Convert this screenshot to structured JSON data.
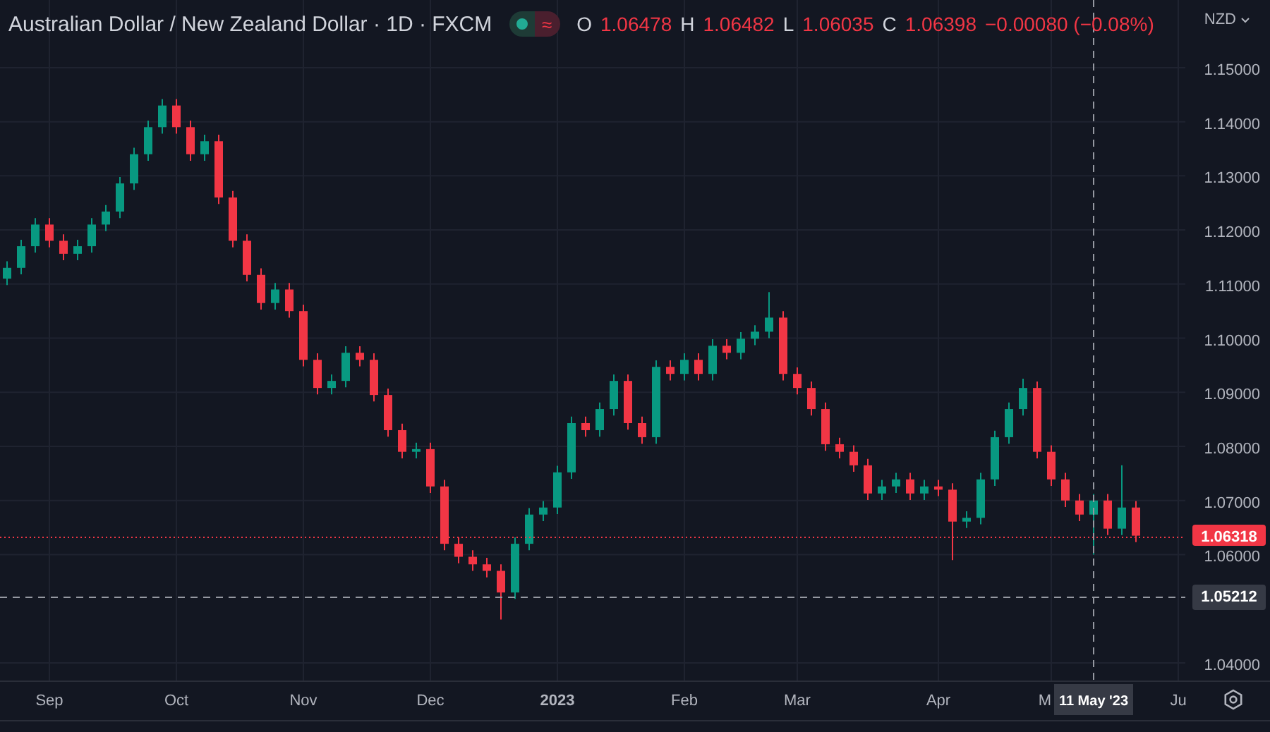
{
  "legend": {
    "title": "Australian Dollar / New Zealand Dollar · 1D · FXCM",
    "market_open": true,
    "status_glyph": "≈",
    "ohlc": [
      {
        "label": "O",
        "value": "1.06478"
      },
      {
        "label": "H",
        "value": "1.06482"
      },
      {
        "label": "L",
        "value": "1.06035"
      },
      {
        "label": "C",
        "value": "1.06398"
      }
    ],
    "change": "−0.00080 (−0.08%)"
  },
  "currency": "NZD",
  "chart_data": {
    "type": "candlestick",
    "grid": true,
    "ylim": [
      1.0366,
      1.1625
    ],
    "categories": [
      null,
      null,
      null,
      "Sep",
      null,
      null,
      null,
      null,
      null,
      null,
      null,
      null,
      "Oct",
      null,
      null,
      null,
      null,
      null,
      null,
      null,
      null,
      "Nov",
      null,
      null,
      null,
      null,
      null,
      null,
      null,
      null,
      "Dec",
      null,
      null,
      null,
      null,
      null,
      null,
      null,
      null,
      "2023",
      null,
      null,
      null,
      null,
      null,
      null,
      null,
      null,
      "Feb",
      null,
      null,
      null,
      null,
      null,
      null,
      null,
      "Mar",
      null,
      null,
      null,
      null,
      null,
      null,
      null,
      null,
      null,
      "Apr",
      null,
      null,
      null,
      null,
      null,
      null,
      null,
      "M",
      null,
      null,
      null,
      null,
      null,
      null,
      null,
      null,
      "Ju"
    ],
    "ohlc": [
      [
        1.111,
        1.1142,
        1.1098,
        1.113
      ],
      [
        1.113,
        1.1182,
        1.1118,
        1.117
      ],
      [
        1.117,
        1.1222,
        1.1158,
        1.121
      ],
      [
        1.121,
        1.1222,
        1.1168,
        1.118
      ],
      [
        1.118,
        1.1192,
        1.1144,
        1.1156
      ],
      [
        1.1156,
        1.1182,
        1.1144,
        1.117
      ],
      [
        1.117,
        1.1222,
        1.1158,
        1.121
      ],
      [
        1.121,
        1.1246,
        1.1198,
        1.1234
      ],
      [
        1.1234,
        1.1298,
        1.1222,
        1.1286
      ],
      [
        1.1286,
        1.1352,
        1.1274,
        1.134
      ],
      [
        1.134,
        1.1402,
        1.1328,
        1.139
      ],
      [
        1.139,
        1.1442,
        1.1378,
        1.143
      ],
      [
        1.143,
        1.1442,
        1.1378,
        1.139
      ],
      [
        1.139,
        1.1402,
        1.1328,
        1.134
      ],
      [
        1.134,
        1.1376,
        1.1328,
        1.1364
      ],
      [
        1.1364,
        1.1376,
        1.1248,
        1.126
      ],
      [
        1.126,
        1.1272,
        1.1168,
        1.118
      ],
      [
        1.118,
        1.1192,
        1.1105,
        1.1117
      ],
      [
        1.1117,
        1.1129,
        1.1053,
        1.1065
      ],
      [
        1.1065,
        1.1102,
        1.1053,
        1.109
      ],
      [
        1.109,
        1.1102,
        1.1038,
        1.105
      ],
      [
        1.105,
        1.1062,
        1.0948,
        1.096
      ],
      [
        1.096,
        1.0972,
        1.0896,
        1.0908
      ],
      [
        1.0908,
        1.0933,
        1.0896,
        1.0921
      ],
      [
        1.0921,
        1.0985,
        1.0909,
        1.0973
      ],
      [
        1.0973,
        1.0985,
        1.0948,
        1.096
      ],
      [
        1.096,
        1.0972,
        1.0883,
        1.0895
      ],
      [
        1.0895,
        1.0907,
        1.0818,
        1.083
      ],
      [
        1.083,
        1.0842,
        1.0778,
        1.079
      ],
      [
        1.079,
        1.0807,
        1.0778,
        1.0795
      ],
      [
        1.0795,
        1.0807,
        1.0714,
        1.0726
      ],
      [
        1.0726,
        1.0738,
        1.0608,
        1.062
      ],
      [
        1.062,
        1.0632,
        1.0584,
        1.0596
      ],
      [
        1.0596,
        1.0608,
        1.057,
        1.0582
      ],
      [
        1.0582,
        1.0594,
        1.0558,
        1.057
      ],
      [
        1.057,
        1.0582,
        1.048,
        1.053
      ],
      [
        1.053,
        1.0632,
        1.0518,
        1.062
      ],
      [
        1.062,
        1.0686,
        1.0608,
        1.0674
      ],
      [
        1.0674,
        1.0699,
        1.0662,
        1.0687
      ],
      [
        1.0687,
        1.0764,
        1.0675,
        1.0752
      ],
      [
        1.0752,
        1.0855,
        1.074,
        1.0843
      ],
      [
        1.0843,
        1.0855,
        1.0818,
        1.083
      ],
      [
        1.083,
        1.0881,
        1.0818,
        1.0869
      ],
      [
        1.0869,
        1.0933,
        1.0857,
        1.0921
      ],
      [
        1.0921,
        1.0933,
        1.0831,
        1.0843
      ],
      [
        1.0843,
        1.0855,
        1.0805,
        1.0817
      ],
      [
        1.0817,
        1.0959,
        1.0805,
        1.0947
      ],
      [
        1.0947,
        1.0959,
        1.0922,
        1.0934
      ],
      [
        1.0934,
        1.0972,
        1.0922,
        1.096
      ],
      [
        1.096,
        1.0972,
        1.0922,
        1.0934
      ],
      [
        1.0934,
        1.0998,
        1.0922,
        1.0986
      ],
      [
        1.0986,
        1.0998,
        1.0961,
        1.0973
      ],
      [
        1.0973,
        1.1011,
        1.0961,
        1.0999
      ],
      [
        1.0999,
        1.1024,
        1.0987,
        1.1012
      ],
      [
        1.1012,
        1.1085,
        1.1,
        1.1038
      ],
      [
        1.1038,
        1.105,
        1.0922,
        1.0934
      ],
      [
        1.0934,
        1.0946,
        1.0896,
        1.0908
      ],
      [
        1.0908,
        1.092,
        1.0857,
        1.0869
      ],
      [
        1.0869,
        1.0881,
        1.0792,
        1.0804
      ],
      [
        1.0804,
        1.0816,
        1.0778,
        1.079
      ],
      [
        1.079,
        1.0802,
        1.0753,
        1.0765
      ],
      [
        1.0765,
        1.0777,
        1.0701,
        1.0713
      ],
      [
        1.0713,
        1.0738,
        1.0701,
        1.0726
      ],
      [
        1.0726,
        1.0751,
        1.0714,
        1.0739
      ],
      [
        1.0739,
        1.0751,
        1.0701,
        1.0713
      ],
      [
        1.0713,
        1.0738,
        1.0701,
        1.0726
      ],
      [
        1.0726,
        1.0738,
        1.0708,
        1.072
      ],
      [
        1.072,
        1.0732,
        1.059,
        1.0661
      ],
      [
        1.0661,
        1.068,
        1.0649,
        1.0668
      ],
      [
        1.0668,
        1.0751,
        1.0656,
        1.0739
      ],
      [
        1.0739,
        1.0829,
        1.0727,
        1.0817
      ],
      [
        1.0817,
        1.0881,
        1.0805,
        1.0869
      ],
      [
        1.0869,
        1.0925,
        1.0857,
        1.0908
      ],
      [
        1.0908,
        1.092,
        1.0778,
        1.079
      ],
      [
        1.079,
        1.0802,
        1.0727,
        1.0739
      ],
      [
        1.0739,
        1.0751,
        1.0688,
        1.07
      ],
      [
        1.07,
        1.0712,
        1.0662,
        1.0674
      ],
      [
        1.0674,
        1.0712,
        1.06,
        1.07
      ],
      [
        1.07,
        1.0712,
        1.0636,
        1.0648
      ],
      [
        1.0648,
        1.0765,
        1.0636,
        1.0687
      ],
      [
        1.0687,
        1.0699,
        1.0623,
        1.0635
      ],
      null,
      null,
      null
    ],
    "yticks": [
      {
        "value": 1.15,
        "label": "1.15000"
      },
      {
        "value": 1.14,
        "label": "1.14000"
      },
      {
        "value": 1.13,
        "label": "1.13000"
      },
      {
        "value": 1.12,
        "label": "1.12000"
      },
      {
        "value": 1.11,
        "label": "1.11000"
      },
      {
        "value": 1.1,
        "label": "1.10000"
      },
      {
        "value": 1.09,
        "label": "1.09000"
      },
      {
        "value": 1.08,
        "label": "1.08000"
      },
      {
        "value": 1.07,
        "label": "1.07000"
      },
      {
        "value": 1.06,
        "label": "1.06000"
      },
      {
        "value": 1.04,
        "label": "1.04000"
      }
    ],
    "ref_lines": [
      {
        "axis": "y",
        "value": 1.06318,
        "label": "1.06318",
        "color": "#f23645"
      },
      {
        "axis": "y",
        "value": 1.05212,
        "label": "1.05212",
        "color": "#9598a1"
      }
    ]
  },
  "crosshair": {
    "date_label": "11 May '23"
  }
}
